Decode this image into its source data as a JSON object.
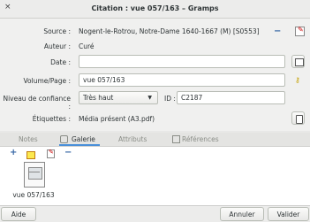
{
  "window": {
    "title": "Citation : vue 057/163 – Gramps",
    "close_glyph": "×"
  },
  "source": {
    "label": "Source :",
    "value": "Nogent-le-Rotrou, Notre-Dame 1640-1667 (M) [S0553]"
  },
  "auteur": {
    "label": "Auteur :",
    "value": "Curé"
  },
  "date": {
    "label": "Date :",
    "value": ""
  },
  "volume": {
    "label": "Volume/Page :",
    "value": "vue 057/163"
  },
  "confiance": {
    "label": "Niveau de confiance :",
    "value": "Très haut"
  },
  "id": {
    "label": "ID :",
    "value": "C2187"
  },
  "etiquettes": {
    "label": "Étiquettes :",
    "value": "Média présent (A3.pdf)"
  },
  "tabs": [
    {
      "label": "Notes"
    },
    {
      "label": "Galerie"
    },
    {
      "label": "Attributs"
    },
    {
      "label": "Références"
    }
  ],
  "gallery": {
    "items": [
      {
        "caption": "vue 057/163"
      }
    ]
  },
  "buttons": {
    "help": "Aide",
    "cancel": "Annuler",
    "ok": "Valider"
  },
  "colors": {
    "accent": "#4a90d9",
    "minus": "#3465a4",
    "edit": "#cc0000",
    "key": "#c4a000"
  }
}
